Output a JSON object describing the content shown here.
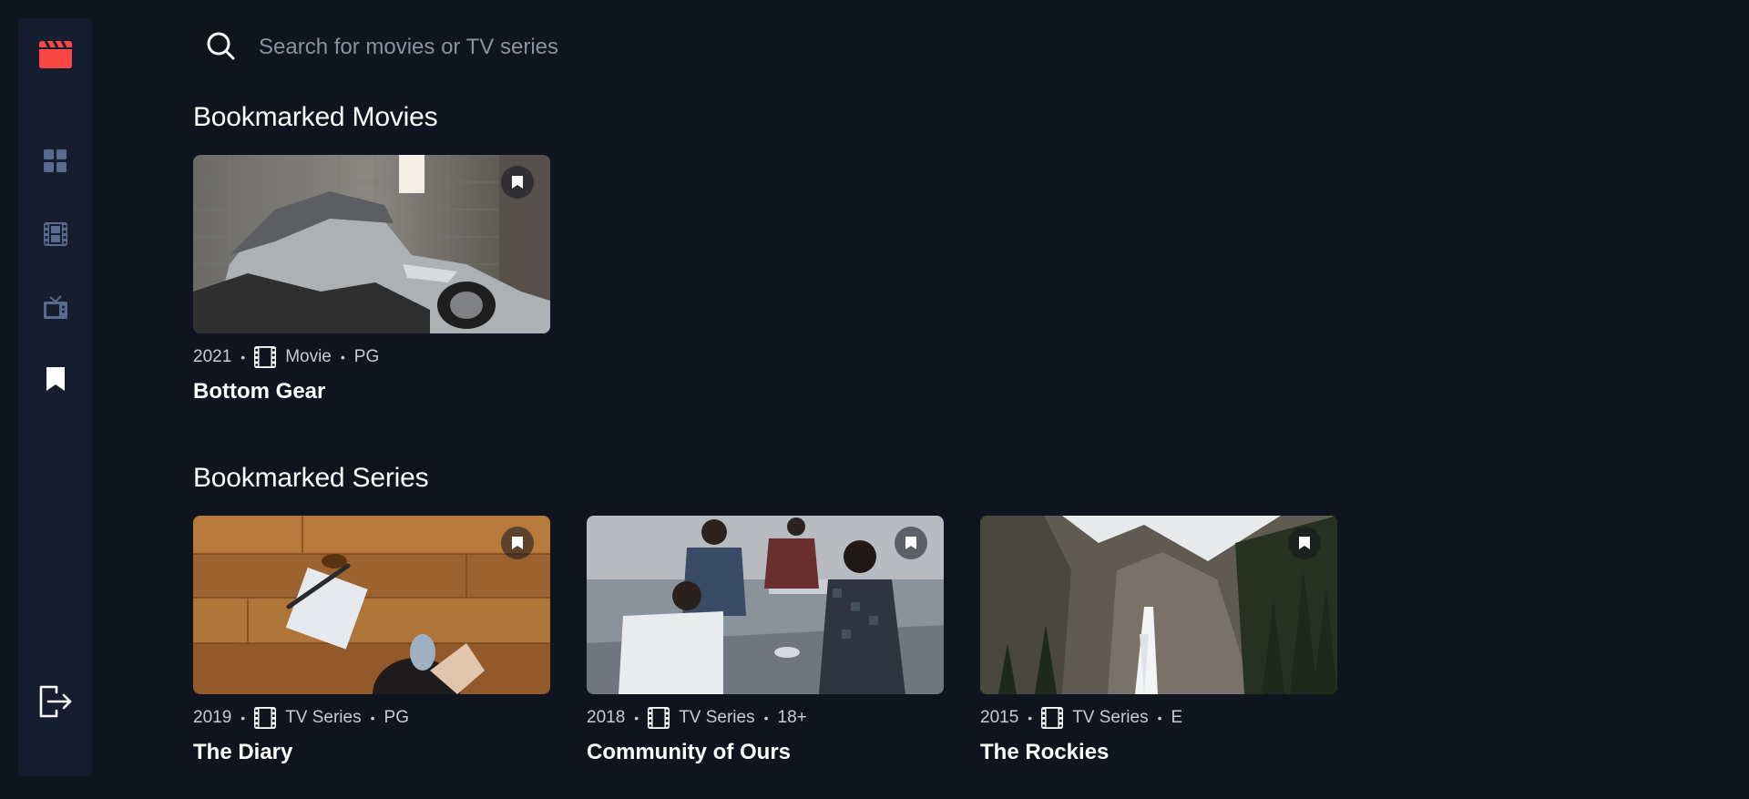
{
  "app": {
    "accent_color": "#fc4747",
    "background_color": "#10141e",
    "sidebar_color": "#161d2f"
  },
  "sidebar": {
    "logo_icon": "clapperboard-icon",
    "items": [
      {
        "icon": "grid-icon",
        "active": false
      },
      {
        "icon": "film-icon",
        "active": false
      },
      {
        "icon": "tv-icon",
        "active": false
      },
      {
        "icon": "bookmark-icon",
        "active": true
      }
    ],
    "logout_icon": "logout-icon"
  },
  "search": {
    "placeholder": "Search for movies or TV series",
    "value": ""
  },
  "movies_section": {
    "title": "Bookmarked Movies",
    "items": [
      {
        "year": "2021",
        "category": "Movie",
        "rating": "PG",
        "title": "Bottom Gear",
        "bookmarked": true
      }
    ]
  },
  "series_section": {
    "title": "Bookmarked Series",
    "items": [
      {
        "year": "2019",
        "category": "TV Series",
        "rating": "PG",
        "title": "The Diary",
        "bookmarked": true
      },
      {
        "year": "2018",
        "category": "TV Series",
        "rating": "18+",
        "title": "Community of Ours",
        "bookmarked": true
      },
      {
        "year": "2015",
        "category": "TV Series",
        "rating": "E",
        "title": "The Rockies",
        "bookmarked": true
      }
    ]
  }
}
